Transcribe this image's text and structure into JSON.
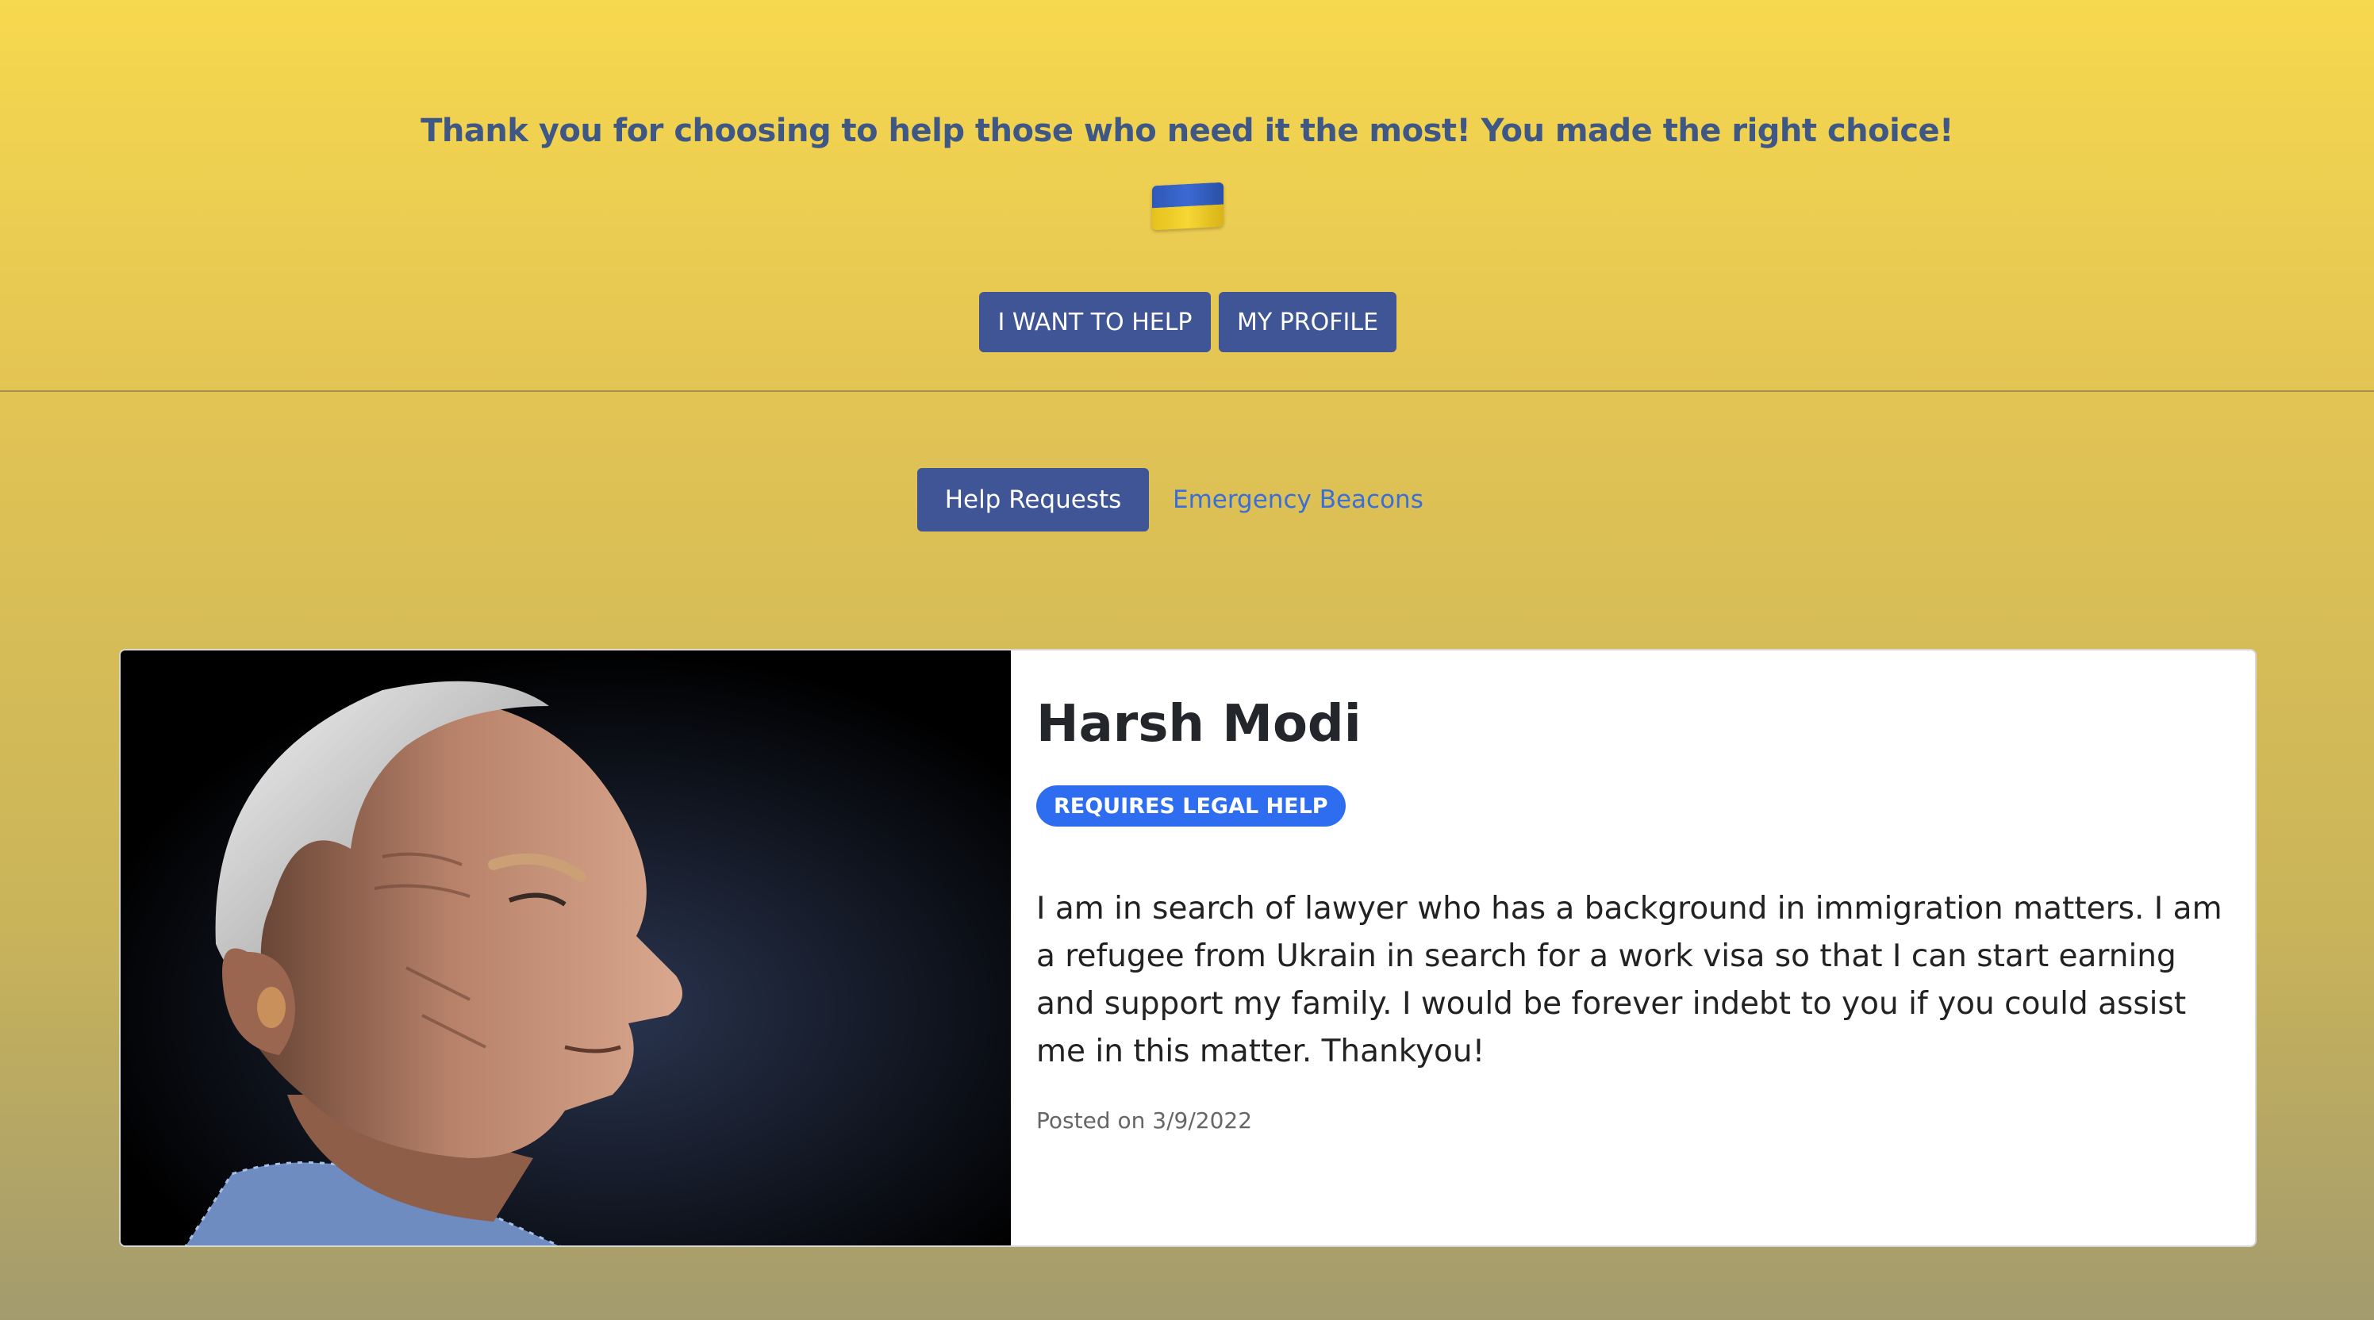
{
  "header": {
    "thanks_message": "Thank you for choosing to help those who need it the most! You made the right choice!",
    "flag_icon": "ukraine-flag-icon",
    "buttons": {
      "want_to_help": "I WANT TO HELP",
      "my_profile": "MY PROFILE"
    }
  },
  "tabs": {
    "active": "Help Requests",
    "other": "Emergency Beacons"
  },
  "request_card": {
    "name": "Harsh Modi",
    "badge": "REQUIRES LEGAL HELP",
    "description": "I am in search of lawyer who has a background in immigration matters. I am a refugee from Ukrain in search for a work visa so that I can start earning and support my family. I would be forever indebt to you if you could assist me in this matter. Thankyou!",
    "posted": "Posted on 3/9/2022"
  },
  "colors": {
    "primary_button": "#3f5596",
    "badge": "#2f6df0",
    "link": "#3a6ed8",
    "heading_text": "#3f5785"
  }
}
